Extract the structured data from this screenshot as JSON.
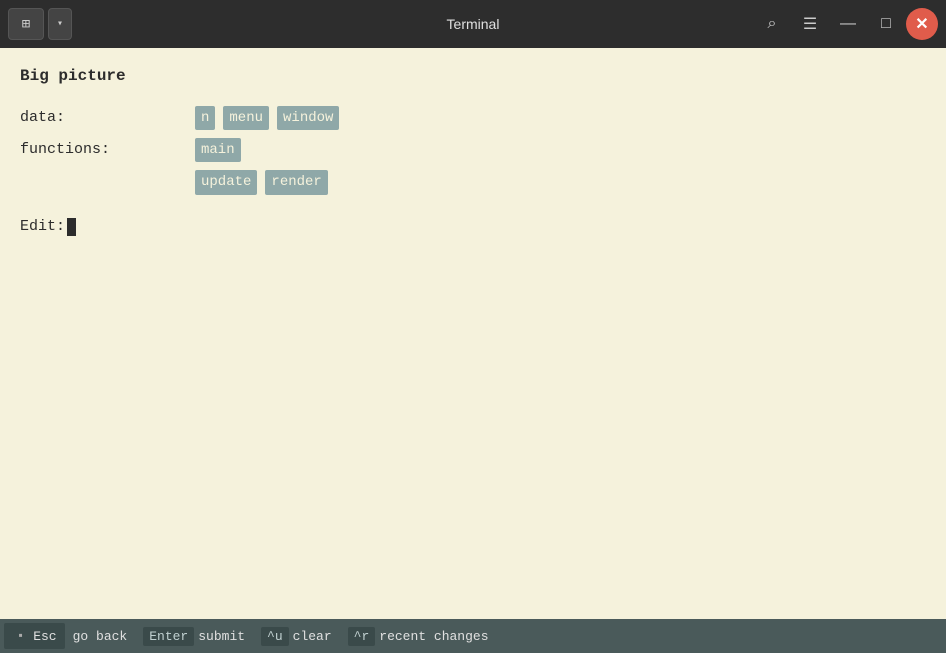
{
  "titlebar": {
    "title": "Terminal",
    "pin_icon": "📌",
    "dropdown_icon": "▾",
    "search_icon": "🔍",
    "menu_icon": "☰",
    "minimize_icon": "—",
    "maximize_icon": "□",
    "close_icon": "✕"
  },
  "terminal": {
    "big_picture_label": "Big picture",
    "data_label": "data:",
    "data_items": [
      "n",
      "menu",
      "window"
    ],
    "functions_label": "functions:",
    "functions_row1": [
      "main"
    ],
    "functions_row2": [
      "update",
      "render"
    ],
    "edit_label": "Edit:"
  },
  "bottom_bar": {
    "items": [
      {
        "key": "",
        "label": "Esc"
      },
      {
        "key": "",
        "label": "go back"
      },
      {
        "key": "Enter",
        "label": "submit"
      },
      {
        "key": "^u",
        "label": "clear"
      },
      {
        "key": "^r",
        "label": "recent changes"
      }
    ]
  }
}
